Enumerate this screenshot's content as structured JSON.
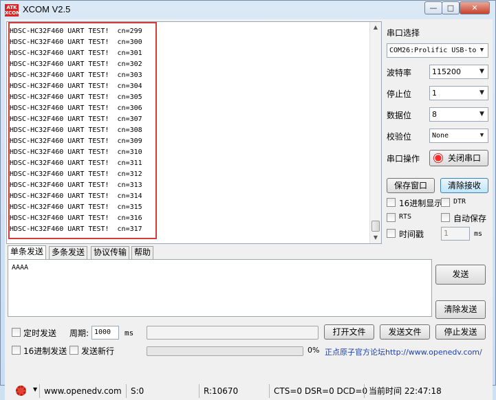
{
  "window": {
    "logo_text": "ATK XCOM",
    "title": "XCOM V2.5",
    "minimize": "—",
    "maximize": "□",
    "close": "✕"
  },
  "receive": {
    "lines": [
      "HDSC-HC32F460 UART TEST!  cn=299",
      "HDSC-HC32F460 UART TEST!  cn=300",
      "HDSC-HC32F460 UART TEST!  cn=301",
      "HDSC-HC32F460 UART TEST!  cn=302",
      "HDSC-HC32F460 UART TEST!  cn=303",
      "HDSC-HC32F460 UART TEST!  cn=304",
      "HDSC-HC32F460 UART TEST!  cn=305",
      "HDSC-HC32F460 UART TEST!  cn=306",
      "HDSC-HC32F460 UART TEST!  cn=307",
      "HDSC-HC32F460 UART TEST!  cn=308",
      "HDSC-HC32F460 UART TEST!  cn=309",
      "HDSC-HC32F460 UART TEST!  cn=310",
      "HDSC-HC32F460 UART TEST!  cn=311",
      "HDSC-HC32F460 UART TEST!  cn=312",
      "HDSC-HC32F460 UART TEST!  cn=313",
      "HDSC-HC32F460 UART TEST!  cn=314",
      "HDSC-HC32F460 UART TEST!  cn=315",
      "HDSC-HC32F460 UART TEST!  cn=316",
      "HDSC-HC32F460 UART TEST!  cn=317"
    ]
  },
  "settings": {
    "port_label": "串口选择",
    "port_value": "COM26:Prolific USB-to",
    "baud_label": "波特率",
    "baud_value": "115200",
    "stop_label": "停止位",
    "stop_value": "1",
    "data_label": "数据位",
    "data_value": "8",
    "parity_label": "校验位",
    "parity_value": "None",
    "op_label": "串口操作",
    "close_port": "关闭串口",
    "save_window": "保存窗口",
    "clear_recv": "清除接收",
    "hex_display": "16进制显示",
    "dtr": "DTR",
    "rts": "RTS",
    "auto_save": "自动保存",
    "timestamp": "时间戳",
    "timestamp_value": "1",
    "ms": "ms"
  },
  "tabs": [
    "单条发送",
    "多条发送",
    "协议传输",
    "帮助"
  ],
  "send": {
    "text": "AAAA",
    "send_button": "发送",
    "clear_send": "清除发送",
    "timed_send": "定时发送",
    "period_label": "周期:",
    "period_value": "1000",
    "ms": "ms",
    "open_file": "打开文件",
    "send_file": "发送文件",
    "stop_send": "停止发送",
    "hex_send": "16进制发送",
    "newline": "发送新行",
    "percent": "0%",
    "forum_link": "正点原子官方论坛http://www.openedv.com/"
  },
  "statusbar": {
    "url": "www.openedv.com",
    "sent": "S:0",
    "received": "R:10670",
    "lines": "CTS=0 DSR=0 DCD=0",
    "time": "当前时间 22:47:18"
  },
  "colors": {
    "accent_red": "#d73a3a",
    "link_blue": "#1a3fb3"
  }
}
